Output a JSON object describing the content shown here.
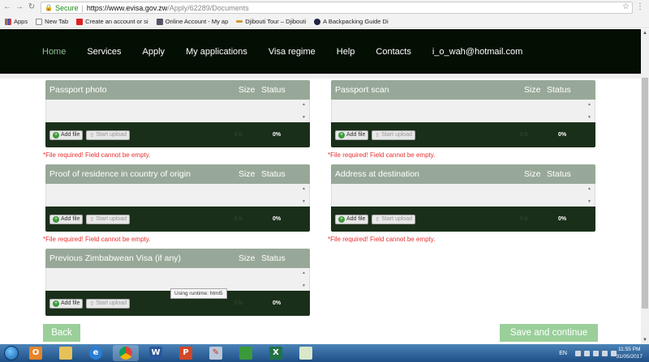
{
  "browser": {
    "secure_label": "Secure",
    "url_domain": "https://www.evisa.gov.zw",
    "url_path": "/Apply/62289/Documents",
    "bookmarks": [
      "Apps",
      "New Tab",
      "Create an account or si",
      "Online Account - My ap",
      "Djibouti Tour – Djibouti",
      "A Backpacking Guide Di"
    ]
  },
  "nav": {
    "items": [
      "Home",
      "Services",
      "Apply",
      "My applications",
      "Visa regime",
      "Help",
      "Contacts",
      "i_o_wah@hotmail.com"
    ]
  },
  "columns": {
    "size": "Size",
    "status": "Status"
  },
  "buttons": {
    "add_file": "Add file",
    "start_upload": "Start upload"
  },
  "panels": [
    {
      "title": "Passport photo",
      "size_value": "0 b",
      "percent": "0%",
      "error": "*File required! Field cannot be empty."
    },
    {
      "title": "Passport scan",
      "size_value": "0 b",
      "percent": "0%",
      "error": "*File required! Field cannot be empty."
    },
    {
      "title": "Proof of residence in country of origin",
      "size_value": "0 b",
      "percent": "0%",
      "error": "*File required! Field cannot be empty."
    },
    {
      "title": "Address at destination",
      "size_value": "0 b",
      "percent": "0%",
      "error": "*File required! Field cannot be empty."
    },
    {
      "title": "Previous Zimbabwean Visa (if any)",
      "size_value": "0 b",
      "percent": "0%",
      "error": ""
    }
  ],
  "tooltip": "Using runtime: html5",
  "footer": {
    "back": "Back",
    "save_continue": "Save and continue"
  },
  "taskbar": {
    "apps": [
      "outlook-app",
      "explorer-app",
      "ie-app",
      "chrome-app",
      "word-app",
      "powerpoint-app",
      "paint-app",
      "folder-app",
      "excel-app",
      "window-app"
    ],
    "language": "EN",
    "time": "11:55 PM",
    "date": "31/05/2017"
  },
  "colors": {
    "nav_bg": "#040f04",
    "panel_header": "#98a898",
    "panel_footer": "#1a2f1a",
    "error": "#e83030",
    "action_button": "#9acf9a"
  }
}
